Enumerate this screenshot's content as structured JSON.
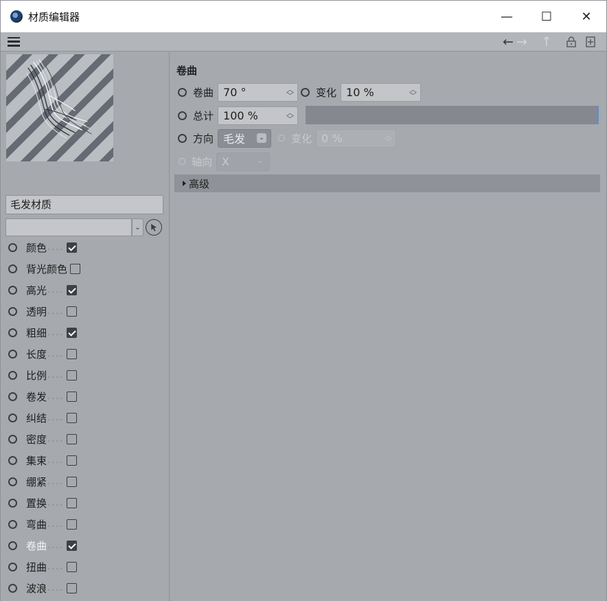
{
  "window": {
    "title": "材质编辑器",
    "controls": {
      "minimize": "—",
      "maximize": "☐",
      "close": "✕"
    }
  },
  "toolbar": {
    "icons": [
      "menu-icon",
      "arrow-left-icon",
      "arrow-right-icon",
      "arrow-up-icon",
      "lock-icon",
      "new-window-icon"
    ]
  },
  "material": {
    "name": "毛发材质",
    "preset": ""
  },
  "channels": [
    {
      "label": "颜色",
      "checked": true,
      "active": false,
      "dots": "...."
    },
    {
      "label": "背光颜色",
      "checked": false,
      "active": false,
      "dots": ""
    },
    {
      "label": "高光",
      "checked": true,
      "active": false,
      "dots": "...."
    },
    {
      "label": "透明",
      "checked": false,
      "active": false,
      "dots": "...."
    },
    {
      "label": "粗细",
      "checked": true,
      "active": false,
      "dots": "...."
    },
    {
      "label": "长度",
      "checked": false,
      "active": false,
      "dots": "...."
    },
    {
      "label": "比例",
      "checked": false,
      "active": false,
      "dots": "...."
    },
    {
      "label": "卷发",
      "checked": false,
      "active": false,
      "dots": "...."
    },
    {
      "label": "纠结",
      "checked": false,
      "active": false,
      "dots": "...."
    },
    {
      "label": "密度",
      "checked": false,
      "active": false,
      "dots": "...."
    },
    {
      "label": "集束",
      "checked": false,
      "active": false,
      "dots": "...."
    },
    {
      "label": "绷紧",
      "checked": false,
      "active": false,
      "dots": "...."
    },
    {
      "label": "置换",
      "checked": false,
      "active": false,
      "dots": "...."
    },
    {
      "label": "弯曲",
      "checked": false,
      "active": false,
      "dots": "...."
    },
    {
      "label": "卷曲",
      "checked": true,
      "active": true,
      "dots": "...."
    },
    {
      "label": "扭曲",
      "checked": false,
      "active": false,
      "dots": "...."
    },
    {
      "label": "波浪",
      "checked": false,
      "active": false,
      "dots": "...."
    }
  ],
  "curl": {
    "section_title": "卷曲",
    "curl_label": "卷曲",
    "curl_value": "70 °",
    "variation_label": "变化",
    "variation_value": "10 %",
    "total_label": "总计",
    "total_value": "100 %",
    "total_fraction": 1.0,
    "direction_label": "方向",
    "direction_value": "毛发",
    "direction_variation_label": "变化",
    "direction_variation_value": "0 %",
    "axis_label": "轴向",
    "axis_value": "X",
    "advanced_label": "高级"
  }
}
